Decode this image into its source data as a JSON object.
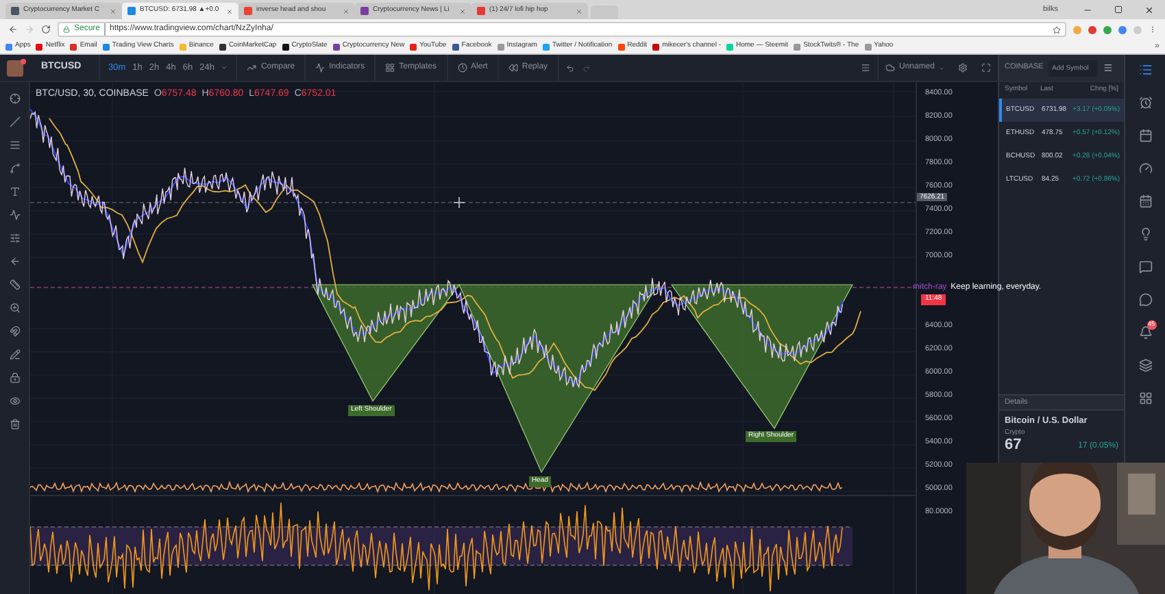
{
  "browser": {
    "tabs": [
      {
        "title": "Cryptocurrency Market C",
        "selected": false
      },
      {
        "title": "BTCUSD: 6731.98 ▲+0.0",
        "selected": true
      },
      {
        "title": "inverse head and shou",
        "selected": false
      },
      {
        "title": "Cryptocurrency News | Li",
        "selected": false
      },
      {
        "title": "(1) 24/7 lofi hip hop",
        "selected": false
      }
    ],
    "user": "bilks",
    "address": {
      "secure_label": "Secure",
      "url": "https://www.tradingview.com/chart/NzZyInha/"
    },
    "bookmarks": [
      "Apps",
      "Netflix",
      "Email",
      "Trading View Charts",
      "Binance",
      "CoinMarketCap",
      "CryptoSlate",
      "Cryptocurrency New",
      "YouTube",
      "Facebook",
      "Instagram",
      "Twitter / Notification",
      "Reddit",
      "mikecer's channel -",
      "Home — Steemit",
      "StockTwits® - The",
      "Yahoo"
    ],
    "more": "»"
  },
  "toolbar": {
    "symbol": "BTCUSD",
    "intervals": [
      {
        "label": "30m",
        "selected": true
      },
      {
        "label": "1h",
        "selected": false
      },
      {
        "label": "2h",
        "selected": false
      },
      {
        "label": "4h",
        "selected": false
      },
      {
        "label": "6h",
        "selected": false
      },
      {
        "label": "24h",
        "selected": false
      }
    ],
    "buttons": [
      "Compare",
      "Indicators",
      "Templates",
      "Alert",
      "Replay"
    ],
    "layout_name": "Unnamed"
  },
  "chart": {
    "title": "BTC/USD, 30, COINBASE",
    "ohlc": [
      {
        "label": "O",
        "value": "6757.48"
      },
      {
        "label": "H",
        "value": "6760.80"
      },
      {
        "label": "L",
        "value": "6747.69"
      },
      {
        "label": "C",
        "value": "6752.01"
      }
    ],
    "price_axis_upper": [
      "8400.00",
      "8200.00",
      "8000.00",
      "7800.00",
      "7600.00",
      "7400.00",
      "7200.00",
      "7000.00"
    ],
    "price_axis_lower": [
      "6400.00",
      "6200.00",
      "6000.00",
      "5800.00",
      "5600.00",
      "5400.00",
      "5200.00",
      "5000.00"
    ],
    "oscillator_axis": "80.0000",
    "crosshair_price": "7626.21",
    "countdown": "11:48",
    "pattern_labels": [
      "Left Shoulder",
      "Head",
      "Right Shoulder"
    ],
    "note": {
      "author": "mitch-ray",
      "text": "Keep learning, everyday."
    }
  },
  "watchlist": {
    "exchange": "COINBASE",
    "add_placeholder": "Add Symbol",
    "columns": [
      "Symbol",
      "Last",
      "Chng [%]"
    ],
    "rows": [
      {
        "symbol": "BTCUSD",
        "last": "6731.98",
        "change": "+3.17 (+0.05%)",
        "selected": true
      },
      {
        "symbol": "ETHUSD",
        "last": "478.75",
        "change": "+0.57 (+0.12%)",
        "selected": false
      },
      {
        "symbol": "BCHUSD",
        "last": "800.02",
        "change": "+0.28 (+0.04%)",
        "selected": false
      },
      {
        "symbol": "LTCUSD",
        "last": "84.25",
        "change": "+0.72 (+0.86%)",
        "selected": false
      }
    ]
  },
  "details": {
    "title": "Details",
    "name": "Bitcoin / U.S. Dollar",
    "type": "Crypto",
    "price": "67",
    "change": "17 (0.05%)"
  },
  "alerts_badge": "45"
}
